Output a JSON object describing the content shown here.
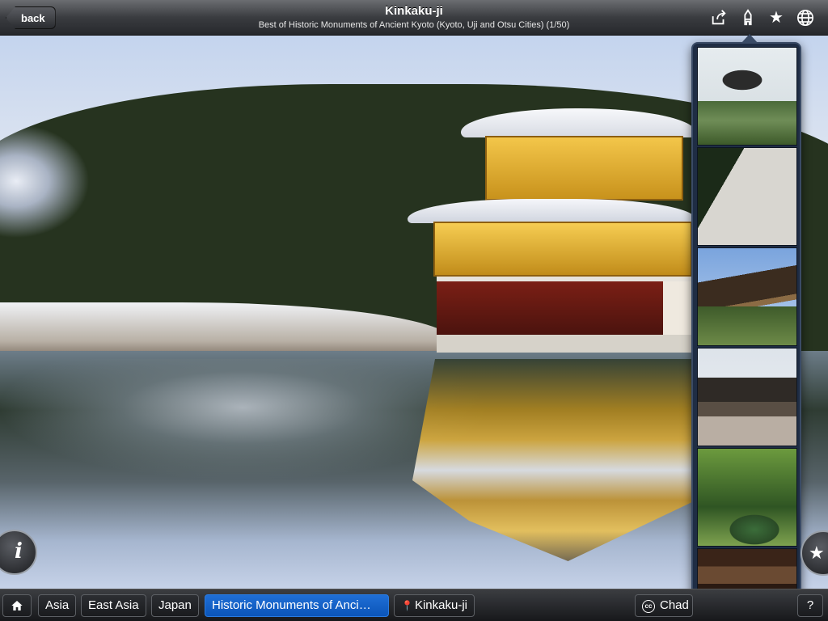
{
  "header": {
    "back_label": "back",
    "title": "Kinkaku-ji",
    "subtitle": "Best of Historic Monuments of Ancient Kyoto (Kyoto, Uji and Otsu Cities) (1/50)"
  },
  "toolbar_icons": [
    "share-icon",
    "map-marker-icon",
    "star-icon",
    "globe-icon"
  ],
  "thumbnails": [
    {
      "id": "thumb-1",
      "depicts": "temple-by-pond"
    },
    {
      "id": "thumb-2",
      "depicts": "raked-sand-garden"
    },
    {
      "id": "thumb-3",
      "depicts": "wooden-temple-hillside"
    },
    {
      "id": "thumb-4",
      "depicts": "temple-hall-courtyard"
    },
    {
      "id": "thumb-5",
      "depicts": "moss-garden"
    },
    {
      "id": "thumb-6",
      "depicts": "wooden-corridor"
    }
  ],
  "floating": {
    "info_label": "i",
    "fav_label": "★"
  },
  "breadcrumbs": {
    "items": [
      {
        "label": "Asia"
      },
      {
        "label": "East Asia"
      },
      {
        "label": "Japan"
      },
      {
        "label": "Historic Monuments of Anci…"
      },
      {
        "label": "Kinkaku-ji"
      }
    ],
    "credit": "Chad",
    "credit_badge": "cc",
    "help_label": "?"
  },
  "colors": {
    "active_crumb": "#0b55b8",
    "popover_bg": "#1f2d44"
  }
}
